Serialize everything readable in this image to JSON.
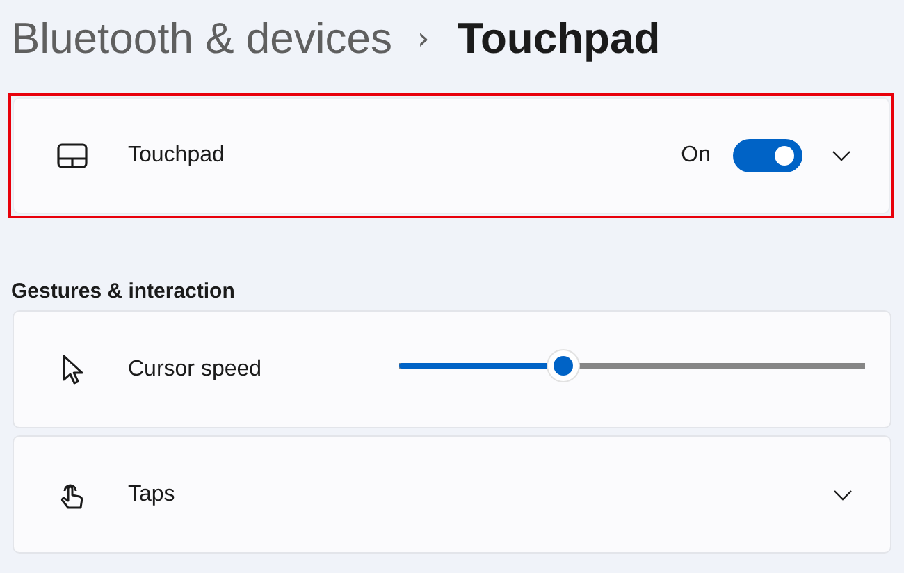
{
  "breadcrumb": {
    "parent": "Bluetooth & devices",
    "separator": "›",
    "current": "Touchpad"
  },
  "touchpad_card": {
    "kind": "toggle",
    "label": "Touchpad",
    "state_text": "On",
    "on": true,
    "highlighted": true,
    "expanded": false
  },
  "section_title": "Gestures & interaction",
  "settings": [
    {
      "kind": "slider",
      "label": "Cursor speed",
      "level": 0.34
    },
    {
      "kind": "expander",
      "label": "Taps",
      "expanded": false
    }
  ]
}
